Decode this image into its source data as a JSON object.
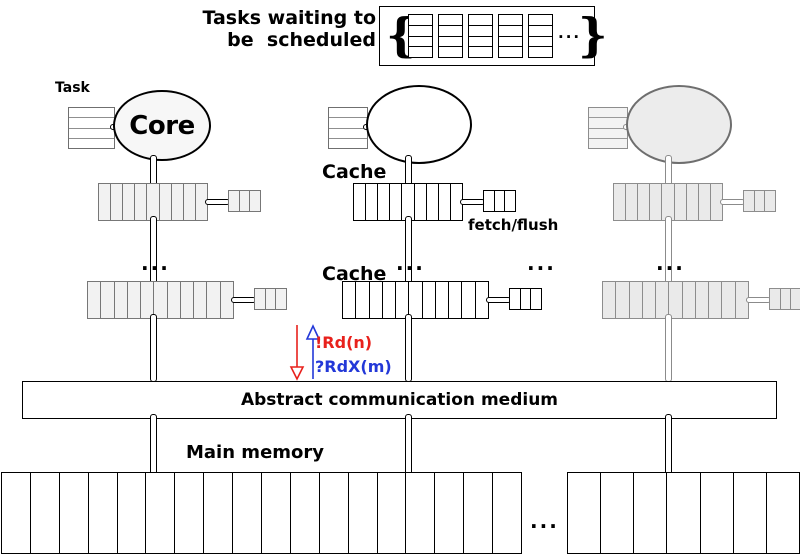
{
  "diagram": {
    "title_text": "Tasks waiting to\nbe  scheduled",
    "queue": {
      "open_brace": "{",
      "close_brace": "}",
      "ellipsis": "...",
      "task_count": 5,
      "rows_per_task": 4
    },
    "labels": {
      "task": "Task",
      "core": "Core",
      "cache_l1": "Cache",
      "cache_l2": "Cache",
      "fetch_flush": "fetch/flush",
      "medium": "Abstract communication medium",
      "main_memory": "Main memory",
      "ellipsis": "..."
    },
    "messages": {
      "read": "!Rd(n)",
      "read_exclusive": "?RdX(m)"
    },
    "colors": {
      "read_color": "#e8211c",
      "read_exclusive_color": "#2338d8",
      "ink": "#000000",
      "greyed_stroke": "#8d8d8d",
      "greyed_fill": "#eaeaea",
      "core_fill": "#f7f7f7",
      "background": "#ffffff"
    },
    "structure": {
      "columns": 3,
      "cache_l1_cells": 9,
      "cache_l2_cells": 11,
      "side_box_cells": 3,
      "task_rows": 4,
      "memory_left_cells": 18,
      "memory_right_cells": 7
    }
  }
}
